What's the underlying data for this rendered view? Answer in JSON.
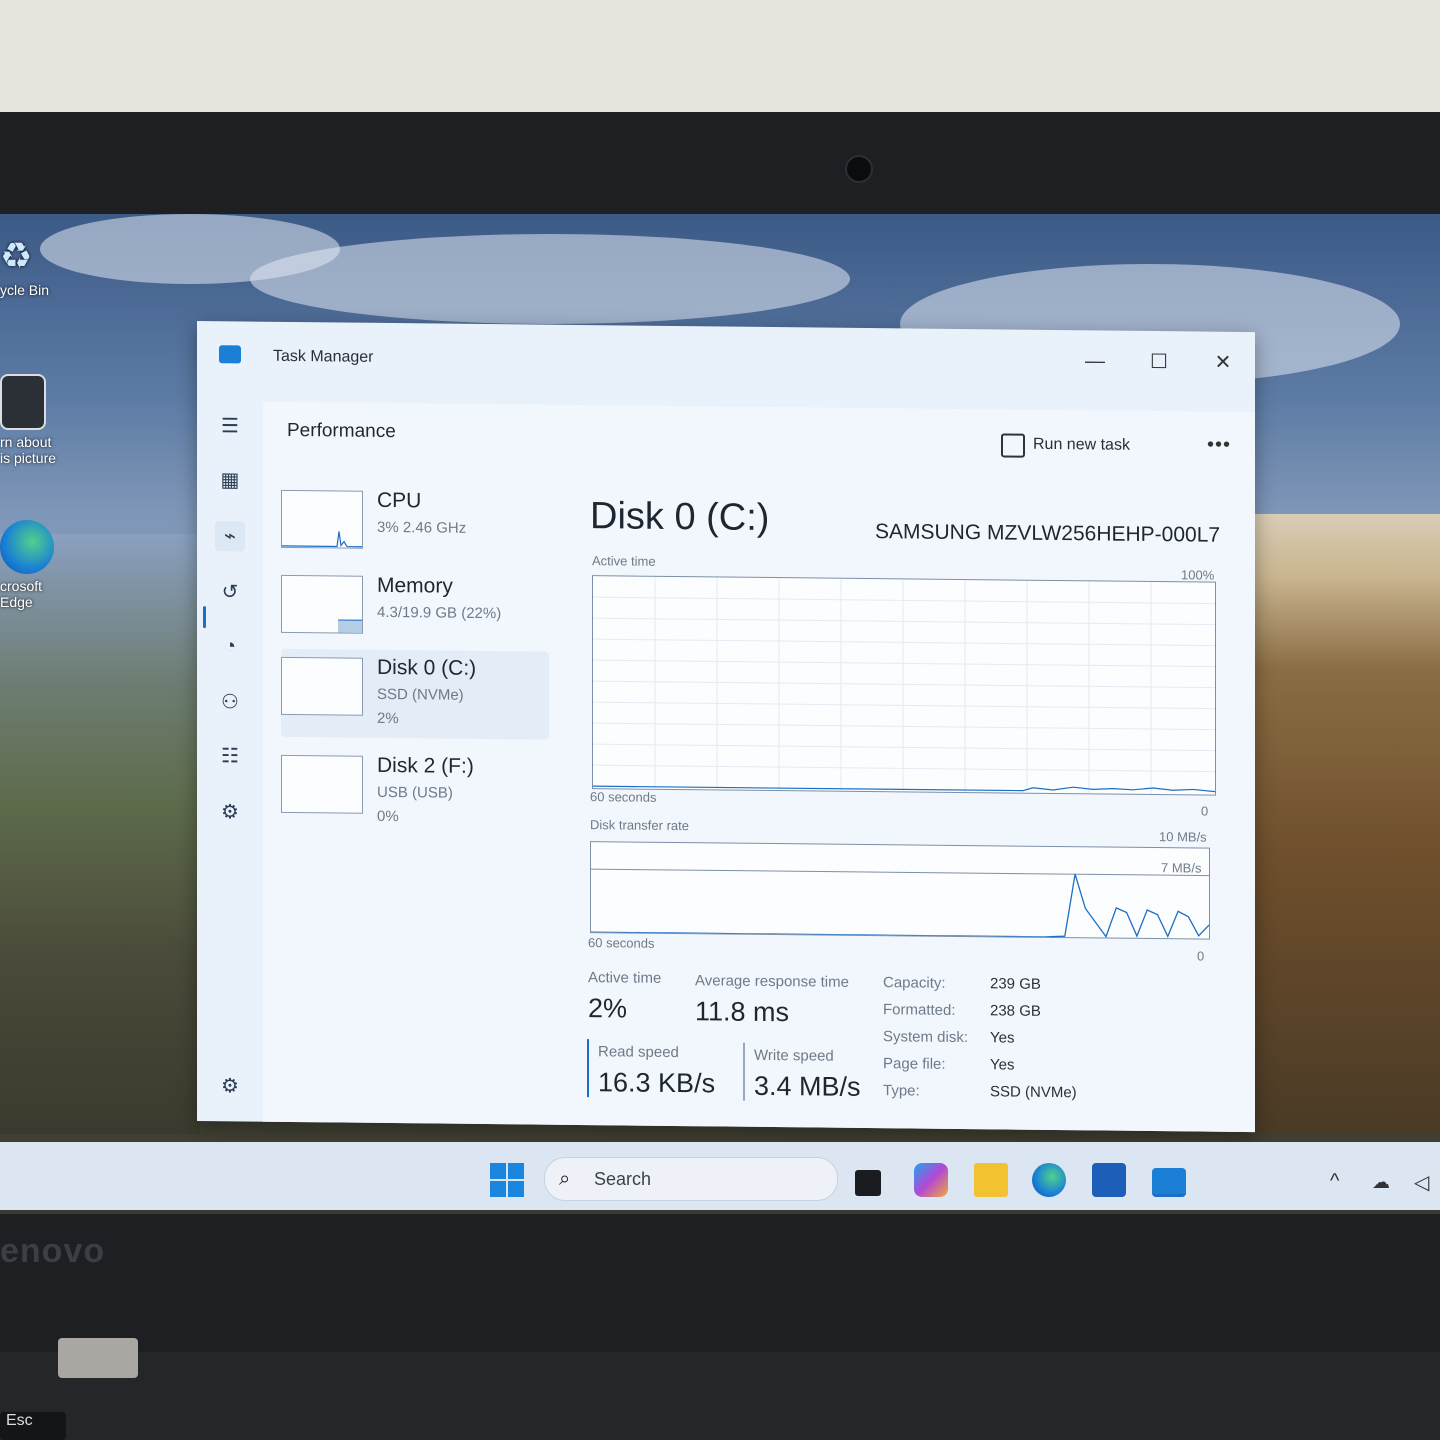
{
  "desktop": {
    "icons": [
      {
        "label": "ycle Bin",
        "name": "recycle-bin"
      },
      {
        "label": "rn about\nis picture",
        "name": "learn-about-picture"
      },
      {
        "label": "crosoft\nEdge",
        "name": "microsoft-edge"
      }
    ]
  },
  "window": {
    "title": "Task Manager",
    "controls": {
      "minimize": "—",
      "maximize": "☐",
      "close": "✕"
    }
  },
  "header": {
    "section_title": "Performance",
    "run_new_task": "Run new task",
    "more": "•••"
  },
  "devices": [
    {
      "name": "CPU",
      "detail": "3%  2.46 GHz",
      "detail2": ""
    },
    {
      "name": "Memory",
      "detail": "4.3/19.9 GB (22%)",
      "detail2": ""
    },
    {
      "name": "Disk 0 (C:)",
      "detail": "SSD (NVMe)",
      "detail2": "2%"
    },
    {
      "name": "Disk 2 (F:)",
      "detail": "USB (USB)",
      "detail2": "0%"
    }
  ],
  "detail": {
    "title": "Disk 0 (C:)",
    "model": "SAMSUNG MZVLW256HEHP-000L7",
    "active_graph": {
      "label": "Active time",
      "max": "100%",
      "time": "60 seconds",
      "min": "0"
    },
    "transfer_graph": {
      "label": "Disk transfer rate",
      "max": "10 MB/s",
      "mid": "7 MB/s",
      "time": "60 seconds",
      "min": "0"
    },
    "stats": {
      "active_time_label": "Active time",
      "active_time": "2%",
      "avg_response_label": "Average response time",
      "avg_response": "11.8 ms",
      "read_label": "Read speed",
      "read": "16.3 KB/s",
      "write_label": "Write speed",
      "write": "3.4 MB/s"
    },
    "props": [
      {
        "k": "Capacity:",
        "v": "239 GB"
      },
      {
        "k": "Formatted:",
        "v": "238 GB"
      },
      {
        "k": "System disk:",
        "v": "Yes"
      },
      {
        "k": "Page file:",
        "v": "Yes"
      },
      {
        "k": "Type:",
        "v": "SSD (NVMe)"
      }
    ]
  },
  "taskbar": {
    "search_placeholder": "Search"
  },
  "brand": "enovo",
  "key_esc": "Esc",
  "chart_data": {
    "type": "line",
    "title": "Disk transfer rate",
    "xlabel": "60 seconds",
    "ylabel": "",
    "ylim": [
      0,
      10
    ],
    "x": [
      0,
      5,
      10,
      15,
      20,
      25,
      30,
      35,
      40,
      42,
      43,
      44,
      46,
      47,
      48,
      50,
      51,
      52,
      53,
      54,
      55,
      56,
      57,
      58,
      59,
      60
    ],
    "series": [
      {
        "values": [
          0,
          0,
          0,
          0,
          0,
          0,
          0,
          0,
          0,
          0,
          0,
          0,
          0.1,
          7,
          3.2,
          0.1,
          3.3,
          2.8,
          0.2,
          3.1,
          2.6,
          0.2,
          3,
          2.4,
          0.3,
          1.5
        ]
      }
    ],
    "accent": "#1c6fc4"
  }
}
